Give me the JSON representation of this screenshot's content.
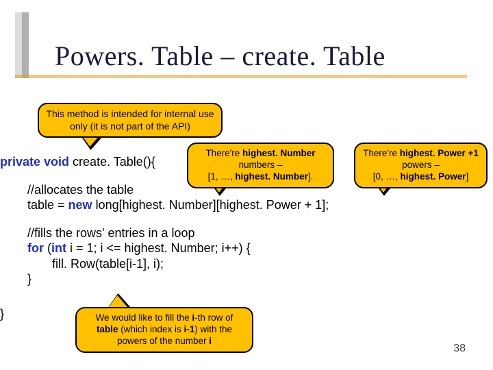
{
  "title": "Powers. Table – create. Table",
  "callout_internal": "This method is intended for internal use only (it is not part of the API)",
  "callout_numbers_p1": "There're ",
  "callout_numbers_b1": "highest. Number",
  "callout_numbers_p2": " numbers – ",
  "callout_numbers_p3": "[1, …, ",
  "callout_numbers_b2": "highest. Number",
  "callout_numbers_p4": "].",
  "callout_powers_p1": "There're ",
  "callout_powers_b1": "highest. Power +1",
  "callout_powers_p2": " powers – ",
  "callout_powers_p3": "[0, …, ",
  "callout_powers_b2": "highest. Power",
  "callout_powers_p4": "]",
  "callout_fill_p1": "We would like to fill the ",
  "callout_fill_b1": "i",
  "callout_fill_p2": "-th row of ",
  "callout_fill_b2": "table",
  "callout_fill_p3": " (which index is ",
  "callout_fill_b3": "i-1",
  "callout_fill_p4": ") with the powers of the number ",
  "callout_fill_b4": "i",
  "code": {
    "kw_private": "private",
    "kw_void": " void",
    "sig_rest": " create. Table(){",
    "c1": "//allocates the table",
    "alloc_a": "table = ",
    "kw_new": "new",
    "alloc_b": " long[highest. Number][highest. Power + 1];",
    "c2": "//fills the rows' entries in a loop",
    "kw_for": "for",
    "for_a": " (",
    "kw_int": "int",
    "for_b": " i = 1; i <= highest. Number; i++) {",
    "fillrow": "fill. Row(table[i-1], i);",
    "brace_close_inner": "}",
    "brace_close_outer": "}"
  },
  "page_number": "38"
}
